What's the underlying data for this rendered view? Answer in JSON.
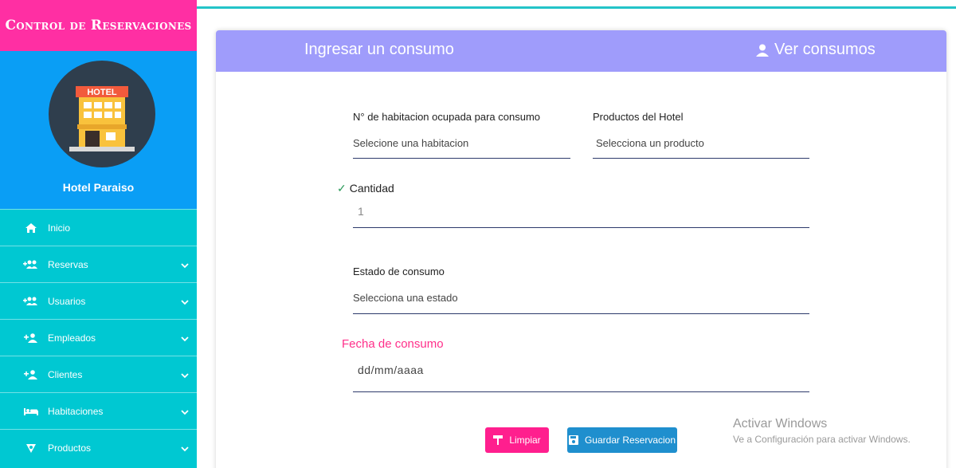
{
  "sidebar": {
    "brand": "Control de Reservaciones",
    "hotel_sign": "HOTEL",
    "hotel_name": "Hotel Paraiso",
    "items": [
      {
        "label": "Inicio",
        "icon": "home-icon"
      },
      {
        "label": "Reservas",
        "icon": "user-group-add-icon"
      },
      {
        "label": "Usuarios",
        "icon": "user-group-add-icon"
      },
      {
        "label": "Empleados",
        "icon": "user-add-icon"
      },
      {
        "label": "Clientes",
        "icon": "user-add-icon"
      },
      {
        "label": "Habitaciones",
        "icon": "bed-icon"
      },
      {
        "label": "Productos",
        "icon": "product-icon"
      }
    ]
  },
  "header": {
    "title": "Ingresar un consumo",
    "view_link": "Ver consumos"
  },
  "form": {
    "room_label": "N° de habitacion ocupada para consumo",
    "room_value": "Selecione una habitacion",
    "product_label": "Productos del Hotel",
    "product_value": "Selecciona un producto",
    "quantity_label": "Cantidad",
    "quantity_value": "1",
    "status_label": "Estado de consumo",
    "status_value": "Selecciona una estado",
    "date_label": "Fecha de consumo",
    "date_placeholder": "dd/mm/aaaa"
  },
  "buttons": {
    "clear": "Limpiar",
    "save": "Guardar Reservacion"
  },
  "watermark": {
    "line1": "Activar Windows",
    "line2": "Ve a Configuración para activar Windows."
  },
  "colors": {
    "brand": "#ff2fa3",
    "sidebar": "#00c8d2",
    "profile": "#0a9ef5",
    "header": "#9f9cfb",
    "clear_button": "#ff1f8e",
    "save_button": "#1f8fce"
  }
}
